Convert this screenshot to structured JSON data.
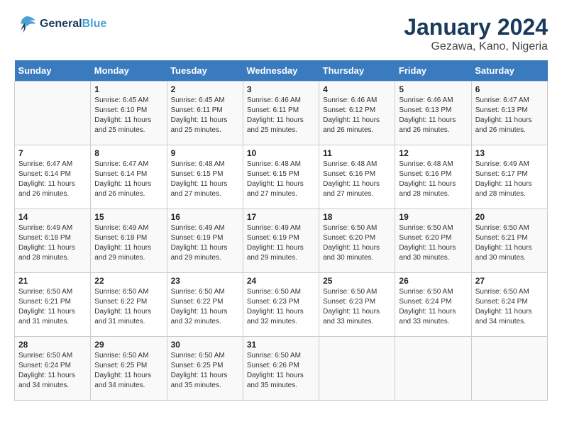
{
  "header": {
    "logo_line1": "General",
    "logo_line2": "Blue",
    "title": "January 2024",
    "subtitle": "Gezawa, Kano, Nigeria"
  },
  "calendar": {
    "days_of_week": [
      "Sunday",
      "Monday",
      "Tuesday",
      "Wednesday",
      "Thursday",
      "Friday",
      "Saturday"
    ],
    "weeks": [
      [
        {
          "day": "",
          "info": ""
        },
        {
          "day": "1",
          "info": "Sunrise: 6:45 AM\nSunset: 6:10 PM\nDaylight: 11 hours and 25 minutes."
        },
        {
          "day": "2",
          "info": "Sunrise: 6:45 AM\nSunset: 6:11 PM\nDaylight: 11 hours and 25 minutes."
        },
        {
          "day": "3",
          "info": "Sunrise: 6:46 AM\nSunset: 6:11 PM\nDaylight: 11 hours and 25 minutes."
        },
        {
          "day": "4",
          "info": "Sunrise: 6:46 AM\nSunset: 6:12 PM\nDaylight: 11 hours and 26 minutes."
        },
        {
          "day": "5",
          "info": "Sunrise: 6:46 AM\nSunset: 6:13 PM\nDaylight: 11 hours and 26 minutes."
        },
        {
          "day": "6",
          "info": "Sunrise: 6:47 AM\nSunset: 6:13 PM\nDaylight: 11 hours and 26 minutes."
        }
      ],
      [
        {
          "day": "7",
          "info": "Sunrise: 6:47 AM\nSunset: 6:14 PM\nDaylight: 11 hours and 26 minutes."
        },
        {
          "day": "8",
          "info": "Sunrise: 6:47 AM\nSunset: 6:14 PM\nDaylight: 11 hours and 26 minutes."
        },
        {
          "day": "9",
          "info": "Sunrise: 6:48 AM\nSunset: 6:15 PM\nDaylight: 11 hours and 27 minutes."
        },
        {
          "day": "10",
          "info": "Sunrise: 6:48 AM\nSunset: 6:15 PM\nDaylight: 11 hours and 27 minutes."
        },
        {
          "day": "11",
          "info": "Sunrise: 6:48 AM\nSunset: 6:16 PM\nDaylight: 11 hours and 27 minutes."
        },
        {
          "day": "12",
          "info": "Sunrise: 6:48 AM\nSunset: 6:16 PM\nDaylight: 11 hours and 28 minutes."
        },
        {
          "day": "13",
          "info": "Sunrise: 6:49 AM\nSunset: 6:17 PM\nDaylight: 11 hours and 28 minutes."
        }
      ],
      [
        {
          "day": "14",
          "info": "Sunrise: 6:49 AM\nSunset: 6:18 PM\nDaylight: 11 hours and 28 minutes."
        },
        {
          "day": "15",
          "info": "Sunrise: 6:49 AM\nSunset: 6:18 PM\nDaylight: 11 hours and 29 minutes."
        },
        {
          "day": "16",
          "info": "Sunrise: 6:49 AM\nSunset: 6:19 PM\nDaylight: 11 hours and 29 minutes."
        },
        {
          "day": "17",
          "info": "Sunrise: 6:49 AM\nSunset: 6:19 PM\nDaylight: 11 hours and 29 minutes."
        },
        {
          "day": "18",
          "info": "Sunrise: 6:50 AM\nSunset: 6:20 PM\nDaylight: 11 hours and 30 minutes."
        },
        {
          "day": "19",
          "info": "Sunrise: 6:50 AM\nSunset: 6:20 PM\nDaylight: 11 hours and 30 minutes."
        },
        {
          "day": "20",
          "info": "Sunrise: 6:50 AM\nSunset: 6:21 PM\nDaylight: 11 hours and 30 minutes."
        }
      ],
      [
        {
          "day": "21",
          "info": "Sunrise: 6:50 AM\nSunset: 6:21 PM\nDaylight: 11 hours and 31 minutes."
        },
        {
          "day": "22",
          "info": "Sunrise: 6:50 AM\nSunset: 6:22 PM\nDaylight: 11 hours and 31 minutes."
        },
        {
          "day": "23",
          "info": "Sunrise: 6:50 AM\nSunset: 6:22 PM\nDaylight: 11 hours and 32 minutes."
        },
        {
          "day": "24",
          "info": "Sunrise: 6:50 AM\nSunset: 6:23 PM\nDaylight: 11 hours and 32 minutes."
        },
        {
          "day": "25",
          "info": "Sunrise: 6:50 AM\nSunset: 6:23 PM\nDaylight: 11 hours and 33 minutes."
        },
        {
          "day": "26",
          "info": "Sunrise: 6:50 AM\nSunset: 6:24 PM\nDaylight: 11 hours and 33 minutes."
        },
        {
          "day": "27",
          "info": "Sunrise: 6:50 AM\nSunset: 6:24 PM\nDaylight: 11 hours and 34 minutes."
        }
      ],
      [
        {
          "day": "28",
          "info": "Sunrise: 6:50 AM\nSunset: 6:24 PM\nDaylight: 11 hours and 34 minutes."
        },
        {
          "day": "29",
          "info": "Sunrise: 6:50 AM\nSunset: 6:25 PM\nDaylight: 11 hours and 34 minutes."
        },
        {
          "day": "30",
          "info": "Sunrise: 6:50 AM\nSunset: 6:25 PM\nDaylight: 11 hours and 35 minutes."
        },
        {
          "day": "31",
          "info": "Sunrise: 6:50 AM\nSunset: 6:26 PM\nDaylight: 11 hours and 35 minutes."
        },
        {
          "day": "",
          "info": ""
        },
        {
          "day": "",
          "info": ""
        },
        {
          "day": "",
          "info": ""
        }
      ]
    ]
  }
}
